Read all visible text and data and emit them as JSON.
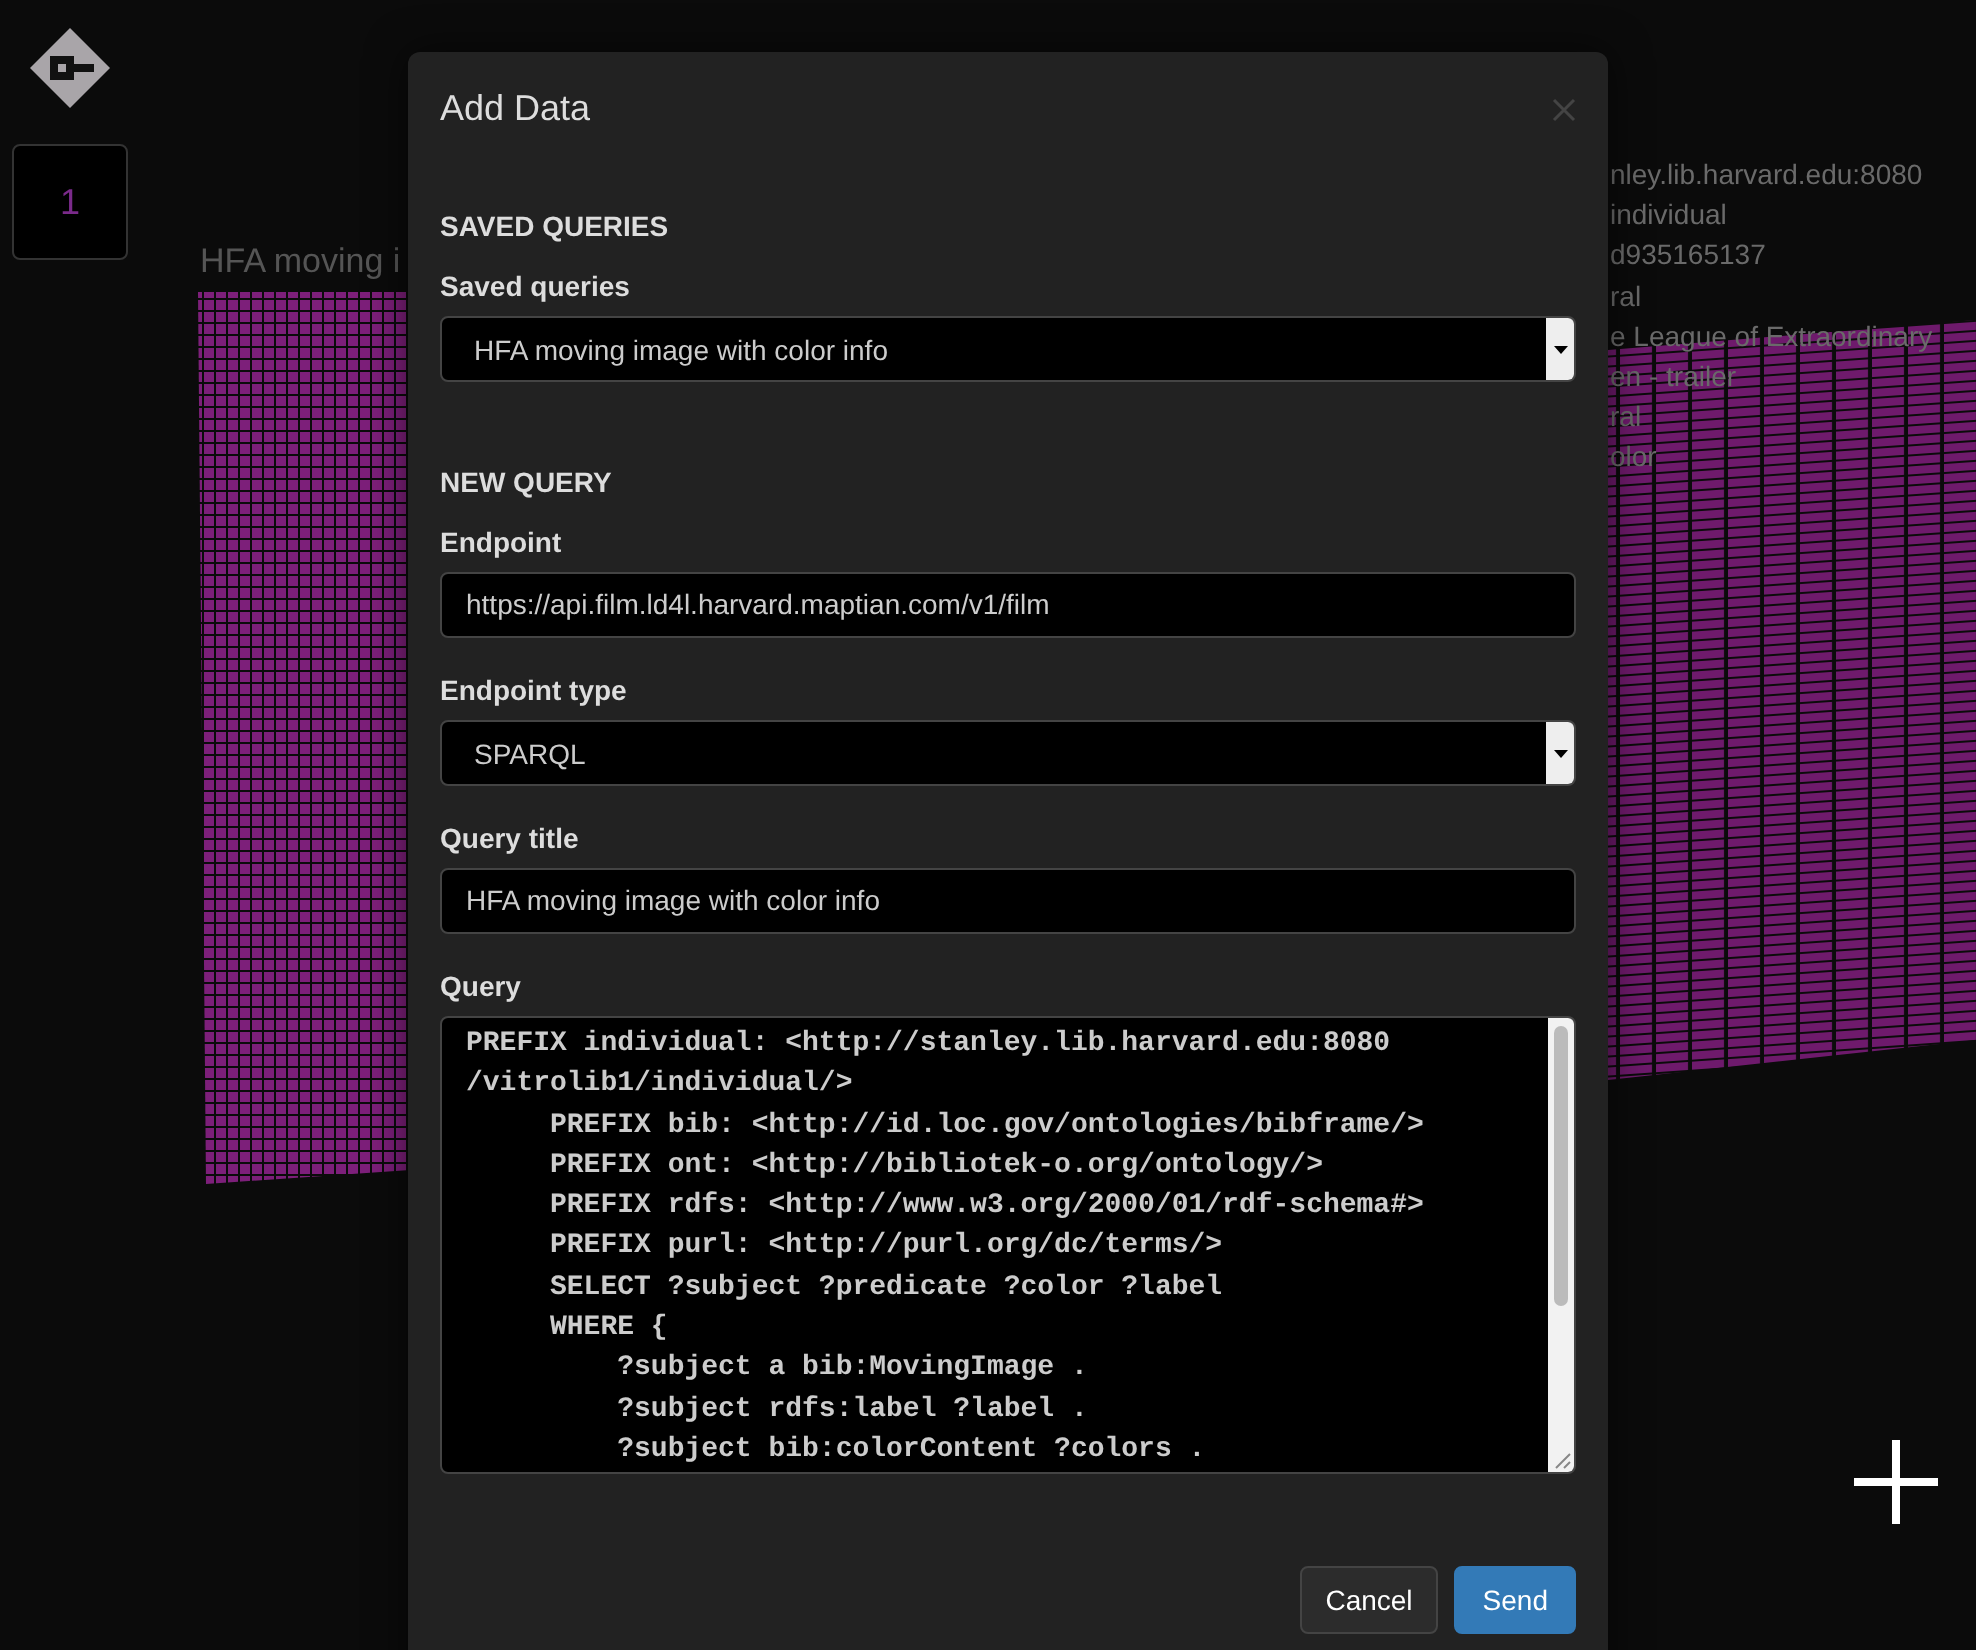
{
  "sidebar": {
    "layer_tile": "1"
  },
  "canvas": {
    "left_label": "HFA moving i",
    "right_lines": [
      "nley.lib.harvard.edu:8080",
      "individual",
      "d935165137",
      "ral",
      "e League of Extraordinary",
      "en - trailer",
      "ral",
      "olor"
    ]
  },
  "dialog": {
    "title": "Add Data",
    "sections": [
      {
        "heading": "SAVED QUERIES",
        "fields": [
          {
            "kind": "select",
            "label": "Saved queries",
            "value": "HFA moving image with color info"
          }
        ]
      },
      {
        "heading": "NEW QUERY",
        "fields": [
          {
            "kind": "input",
            "label": "Endpoint",
            "value": "https://api.film.ld4l.harvard.maptian.com/v1/film"
          },
          {
            "kind": "select",
            "label": "Endpoint type",
            "value": "SPARQL"
          },
          {
            "kind": "input",
            "label": "Query title",
            "value": "HFA moving image with color info"
          },
          {
            "kind": "code",
            "label": "Query",
            "lines": [
              "PREFIX individual: <http://stanley.lib.harvard.edu:8080",
              "/vitrolib1/individual/>",
              "     PREFIX bib: <http://id.loc.gov/ontologies/bibframe/>",
              "     PREFIX ont: <http://bibliotek-o.org/ontology/>",
              "     PREFIX rdfs: <http://www.w3.org/2000/01/rdf-schema#>",
              "     PREFIX purl: <http://purl.org/dc/terms/>",
              "     SELECT ?subject ?predicate ?color ?label",
              "     WHERE {",
              "         ?subject a bib:MovingImage .",
              "         ?subject rdfs:label ?label .",
              "         ?subject bib:colorContent ?colors ."
            ]
          }
        ]
      }
    ],
    "buttons": [
      {
        "label": "Cancel",
        "kind": "default"
      },
      {
        "label": "Send",
        "kind": "primary"
      }
    ]
  }
}
